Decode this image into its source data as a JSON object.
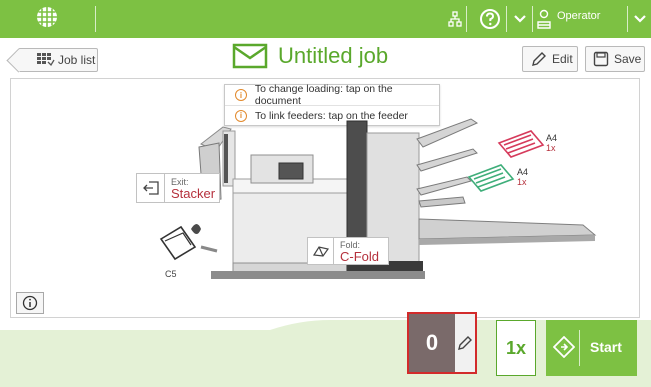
{
  "topbar": {
    "user_label": "Operator",
    "logo_icon": "globe-grid-icon",
    "network_icon": "network-icon",
    "help_icon": "help-icon",
    "user_icon": "operator-icon",
    "color": "#7dc143"
  },
  "jobbar": {
    "job_list_label": "Job list",
    "title": "Untitled job",
    "edit_label": "Edit",
    "save_label": "Save"
  },
  "hints": [
    "To change loading: tap on the document",
    "To link feeders: tap on the feeder"
  ],
  "machine": {
    "exit_caption": "Exit:",
    "exit_value": "Stacker",
    "fold_caption": "Fold:",
    "fold_value": "C-Fold",
    "envelope_label": "C5",
    "feeders": [
      {
        "size": "A4",
        "count": "1x",
        "color": "#d63b5c"
      },
      {
        "size": "A4",
        "count": "1x",
        "color": "#3fae7a"
      }
    ]
  },
  "bottom": {
    "counter_value": "0",
    "multiplier": "1x",
    "start_label": "Start"
  },
  "colors": {
    "accent_green": "#7dc143",
    "text_red": "#b5303c",
    "highlight_red": "#d22b2b"
  }
}
